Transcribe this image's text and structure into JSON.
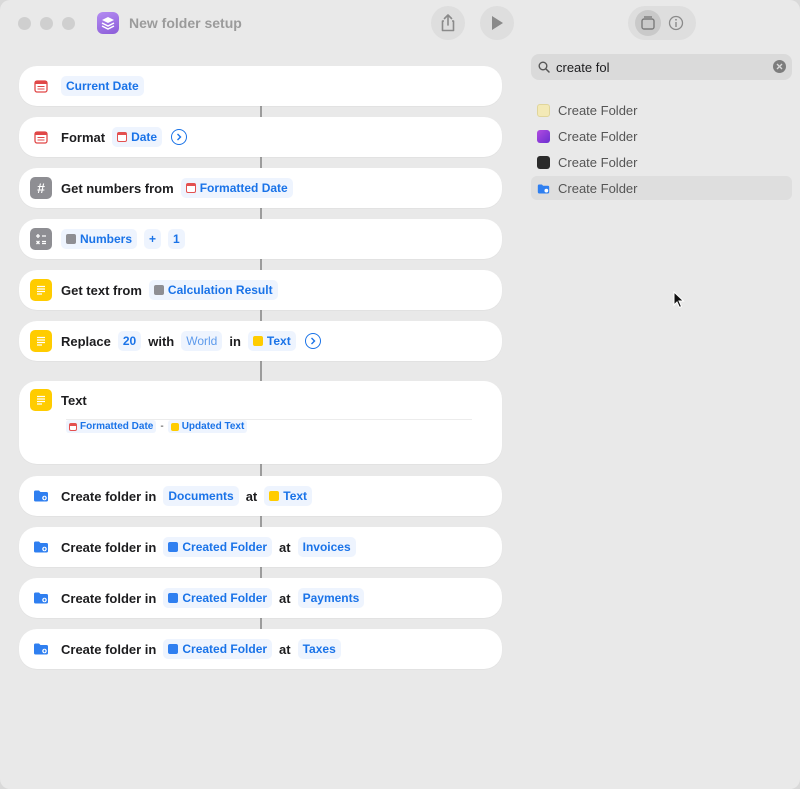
{
  "window": {
    "title": "New folder setup"
  },
  "actions": [
    {
      "label": "",
      "tokens": [
        {
          "text": "Current Date"
        }
      ]
    },
    {
      "label": "Format",
      "tokens": [
        {
          "text": "Date"
        }
      ]
    },
    {
      "label": "Get numbers from",
      "tokens": [
        {
          "text": "Formatted Date"
        }
      ]
    },
    {
      "label": "",
      "tokens": [
        {
          "text": "Numbers"
        },
        {
          "text": "+"
        },
        {
          "text": "1"
        }
      ]
    },
    {
      "label": "Get text from",
      "tokens": [
        {
          "text": "Calculation Result"
        }
      ]
    },
    {
      "label": "Replace",
      "tokens": [
        {
          "text": "20"
        },
        {
          "text": "World"
        },
        {
          "text": "Text"
        }
      ],
      "words": [
        "with",
        "in"
      ]
    },
    {
      "label": "Text",
      "body": {
        "a": "Formatted Date",
        "sep": "-",
        "b": "Updated Text"
      }
    },
    {
      "label": "Create folder in",
      "tokens": [
        {
          "text": "Documents"
        },
        {
          "text": "Text"
        }
      ],
      "words": [
        "at"
      ]
    },
    {
      "label": "Create folder in",
      "tokens": [
        {
          "text": "Created Folder"
        },
        {
          "text": "Invoices"
        }
      ],
      "words": [
        "at"
      ]
    },
    {
      "label": "Create folder in",
      "tokens": [
        {
          "text": "Created Folder"
        },
        {
          "text": "Payments"
        }
      ],
      "words": [
        "at"
      ]
    },
    {
      "label": "Create folder in",
      "tokens": [
        {
          "text": "Created Folder"
        },
        {
          "text": "Taxes"
        }
      ],
      "words": [
        "at"
      ]
    }
  ],
  "search": {
    "value": "create fol"
  },
  "results": [
    {
      "label": "Create Folder",
      "icon": "notes-icon",
      "color": "#f3e9b6"
    },
    {
      "label": "Create Folder",
      "icon": "app-icon",
      "color": "#8a3fd6"
    },
    {
      "label": "Create Folder",
      "icon": "app-icon",
      "color": "#2b2b2b"
    },
    {
      "label": "Create Folder",
      "icon": "folder-icon",
      "color": "#2f7ff0"
    }
  ]
}
